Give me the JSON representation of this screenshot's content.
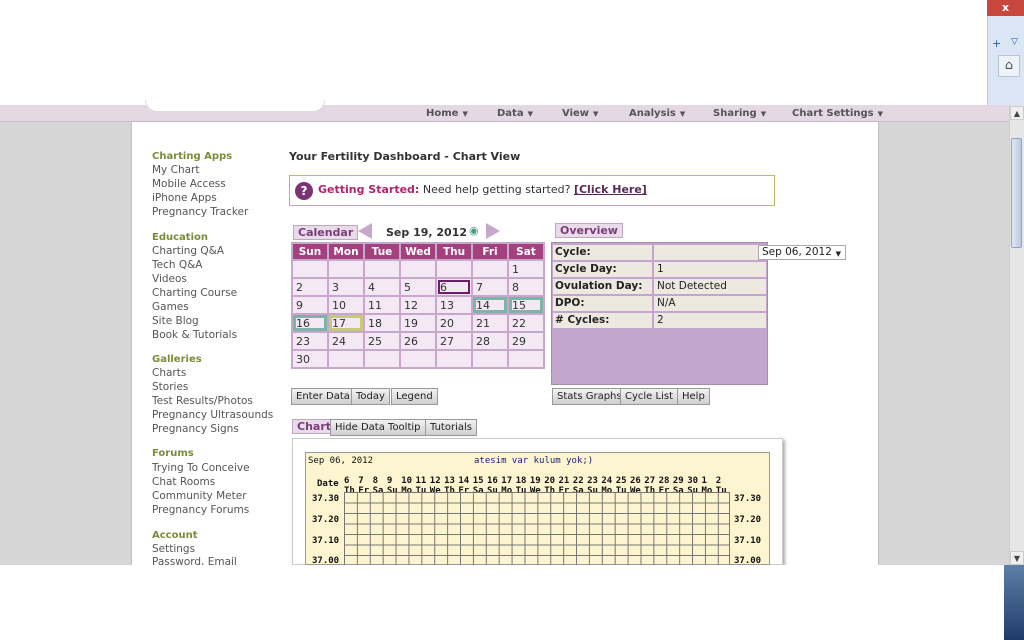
{
  "browser": {
    "close_label": "x",
    "add_icon": "+",
    "dropdown_icon": "▽",
    "home_icon": "⌂"
  },
  "nav": [
    {
      "label": "Home"
    },
    {
      "label": "Data"
    },
    {
      "label": "View"
    },
    {
      "label": "Analysis"
    },
    {
      "label": "Sharing"
    },
    {
      "label": "Chart Settings"
    }
  ],
  "sidebar": {
    "charting_apps": {
      "heading": "Charting Apps",
      "items": [
        "My Chart",
        "Mobile Access",
        "iPhone Apps",
        "Pregnancy Tracker"
      ]
    },
    "education": {
      "heading": "Education",
      "items": [
        "Charting Q&A",
        "Tech Q&A",
        "Videos",
        "Charting Course",
        "Games",
        "Site Blog",
        "Book & Tutorials"
      ]
    },
    "galleries": {
      "heading": "Galleries",
      "items": [
        "Charts",
        "Stories",
        "Test Results/Photos",
        "Pregnancy Ultrasounds",
        "Pregnancy Signs"
      ]
    },
    "forums": {
      "heading": "Forums",
      "items": [
        "Trying To Conceive",
        "Chat Rooms",
        "Community Meter",
        "Pregnancy Forums"
      ]
    },
    "account": {
      "heading": "Account",
      "items": [
        "Settings",
        "Password, Email"
      ]
    }
  },
  "page_title": "Your Fertility Dashboard - Chart View",
  "getting_started": {
    "icon": "?",
    "bold": "Getting Started:",
    "text": "Need help getting started?",
    "link": "[Click Here]"
  },
  "calendar": {
    "label": "Calendar",
    "current_date": "Sep 19, 2012",
    "days": [
      "Sun",
      "Mon",
      "Tue",
      "Wed",
      "Thu",
      "Fri",
      "Sat"
    ],
    "weeks": [
      [
        "",
        "",
        "",
        "",
        "",
        "",
        "1"
      ],
      [
        "2",
        "3",
        "4",
        "5",
        "6",
        "7",
        "8"
      ],
      [
        "9",
        "10",
        "11",
        "12",
        "13",
        "14",
        "15"
      ],
      [
        "16",
        "17",
        "18",
        "19",
        "20",
        "21",
        "22"
      ],
      [
        "23",
        "24",
        "25",
        "26",
        "27",
        "28",
        "29"
      ],
      [
        "30",
        "",
        "",
        "",
        "",
        "",
        ""
      ]
    ],
    "buttons": [
      "Enter Data",
      "Today",
      "Legend"
    ]
  },
  "overview": {
    "label": "Overview",
    "cycle_label": "Cycle:",
    "cycle_value": "Sep 06, 2012",
    "rows": [
      {
        "key": "Cycle Day:",
        "value": "1"
      },
      {
        "key": "Ovulation Day:",
        "value": "Not Detected"
      },
      {
        "key": "DPO:",
        "value": "N/A"
      },
      {
        "key": "# Cycles:",
        "value": "2"
      }
    ],
    "buttons": [
      "Stats Graphs",
      "Cycle List",
      "Help"
    ]
  },
  "chart_section": {
    "label": "Chart",
    "buttons": [
      "Hide Data Tooltip",
      "Tutorials"
    ],
    "start_date": "Sep 06, 2012",
    "title": "atesim var kulum yok;)",
    "date_label": "Date",
    "dates": [
      "6",
      "7",
      "8",
      "9",
      "10",
      "11",
      "12",
      "13",
      "14",
      "15",
      "16",
      "17",
      "18",
      "19",
      "20",
      "21",
      "22",
      "23",
      "24",
      "25",
      "26",
      "27",
      "28",
      "29",
      "30",
      "1",
      "2"
    ],
    "weekdays": [
      "Th",
      "Fr",
      "Sa",
      "Su",
      "Mo",
      "Tu",
      "We",
      "Th",
      "Fr",
      "Sa",
      "Su",
      "Mo",
      "Tu",
      "We",
      "Th",
      "Fr",
      "Sa",
      "Su",
      "Mo",
      "Tu",
      "We",
      "Th",
      "Fr",
      "Sa",
      "Su",
      "Mo",
      "Tu"
    ],
    "temps": [
      "37.30",
      "37.20",
      "37.10",
      "37.00"
    ]
  }
}
